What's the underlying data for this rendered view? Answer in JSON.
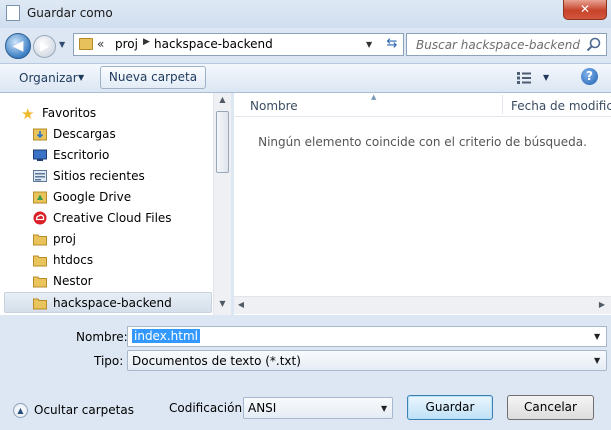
{
  "window": {
    "title": "Guardar como",
    "close_label": "✕"
  },
  "nav": {
    "address": {
      "overflow": "«",
      "crumbs": [
        "proj",
        "hackspace-backend"
      ],
      "separator": "▶"
    },
    "search_placeholder": "Buscar hackspace-backend"
  },
  "toolbar": {
    "organize_label": "Organizar",
    "new_folder_label": "Nueva carpeta",
    "help_label": "?"
  },
  "sidebar": {
    "favorites_label": "Favoritos",
    "items": [
      {
        "label": "Descargas",
        "icon": "downloads-folder-icon"
      },
      {
        "label": "Escritorio",
        "icon": "desktop-icon"
      },
      {
        "label": "Sitios recientes",
        "icon": "recent-places-icon"
      },
      {
        "label": "Google Drive",
        "icon": "google-drive-folder-icon"
      },
      {
        "label": "Creative Cloud Files",
        "icon": "creative-cloud-icon"
      },
      {
        "label": "proj",
        "icon": "folder-icon"
      },
      {
        "label": "htdocs",
        "icon": "folder-icon"
      },
      {
        "label": "Nestor",
        "icon": "folder-icon"
      },
      {
        "label": "hackspace-backend",
        "icon": "folder-icon"
      }
    ],
    "selected_index": 8
  },
  "files": {
    "columns": [
      "Nombre",
      "Fecha de modifica..."
    ],
    "empty_message": "Ningún elemento coincide con el criterio de búsqueda."
  },
  "form": {
    "filename_label": "Nombre:",
    "filename_value": "index.html",
    "type_label": "Tipo:",
    "type_value": "Documentos de texto (*.txt)",
    "encoding_label": "Codificación:",
    "encoding_value": "ANSI",
    "hide_folders_label": "Ocultar carpetas",
    "save_label": "Guardar",
    "cancel_label": "Cancelar"
  },
  "colors": {
    "accent": "#3399ff",
    "close": "#c7432a",
    "frame": "#dce7f3"
  }
}
